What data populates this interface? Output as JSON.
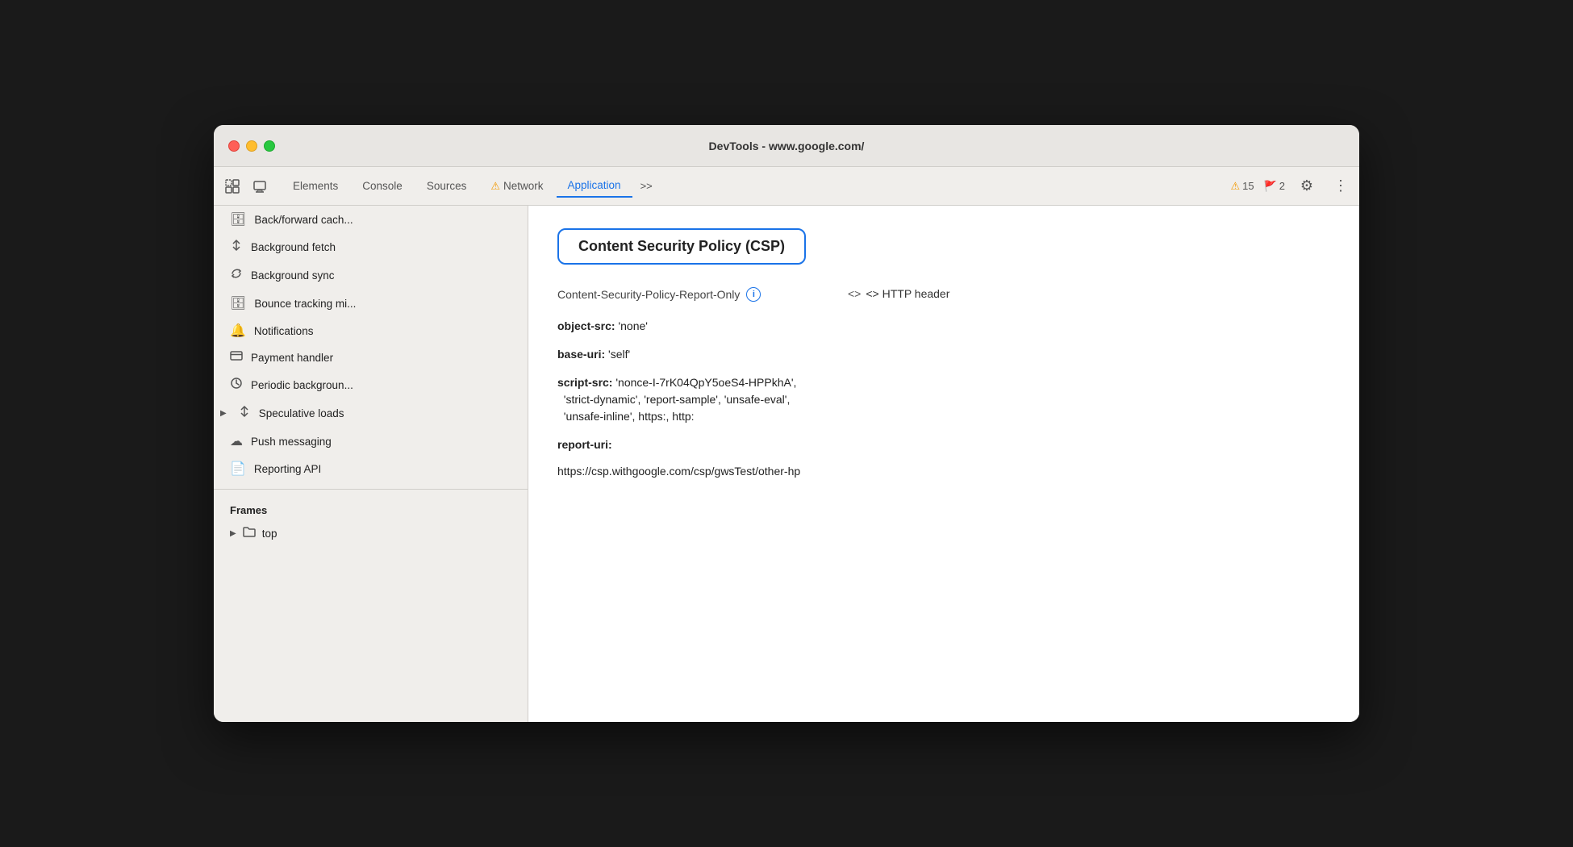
{
  "window": {
    "title": "DevTools - www.google.com/"
  },
  "tabs": [
    {
      "id": "elements",
      "label": "Elements",
      "active": false,
      "warning": false
    },
    {
      "id": "console",
      "label": "Console",
      "active": false,
      "warning": false
    },
    {
      "id": "sources",
      "label": "Sources",
      "active": false,
      "warning": false
    },
    {
      "id": "network",
      "label": "Network",
      "active": false,
      "warning": true
    },
    {
      "id": "application",
      "label": "Application",
      "active": true,
      "warning": false
    }
  ],
  "more_tabs_label": ">>",
  "badges": {
    "warning_count": "15",
    "error_count": "2"
  },
  "sidebar": {
    "items": [
      {
        "id": "back-forward-cache",
        "icon": "🗄",
        "label": "Back/forward cach..."
      },
      {
        "id": "background-fetch",
        "icon": "↕",
        "label": "Background fetch"
      },
      {
        "id": "background-sync",
        "icon": "🔄",
        "label": "Background sync"
      },
      {
        "id": "bounce-tracking",
        "icon": "🗄",
        "label": "Bounce tracking mi..."
      },
      {
        "id": "notifications",
        "icon": "🔔",
        "label": "Notifications"
      },
      {
        "id": "payment-handler",
        "icon": "💳",
        "label": "Payment handler"
      },
      {
        "id": "periodic-background",
        "icon": "🕐",
        "label": "Periodic backgroun..."
      },
      {
        "id": "speculative-loads",
        "icon": "↕",
        "label": "Speculative loads",
        "has_arrow": true
      },
      {
        "id": "push-messaging",
        "icon": "☁",
        "label": "Push messaging"
      },
      {
        "id": "reporting-api",
        "icon": "📄",
        "label": "Reporting API"
      }
    ],
    "frames_label": "Frames",
    "frames_top": "top"
  },
  "content": {
    "title": "Content Security Policy (CSP)",
    "policy_name": "Content-Security-Policy-Report-Only",
    "policy_source_label": "<> HTTP header",
    "directives": [
      {
        "key": "object-src:",
        "value": "'none'"
      },
      {
        "key": "base-uri:",
        "value": "'self'"
      },
      {
        "key": "script-src:",
        "value": "'nonce-I-7rK04QpY5oeS4-HPPkhA', 'strict-dynamic', 'report-sample', 'unsafe-eval', 'unsafe-inline', https:, http:"
      },
      {
        "key": "report-uri:",
        "value": ""
      },
      {
        "key": "url",
        "value": "https://csp.withgoogle.com/csp/gwsTest/other-hp"
      }
    ]
  }
}
